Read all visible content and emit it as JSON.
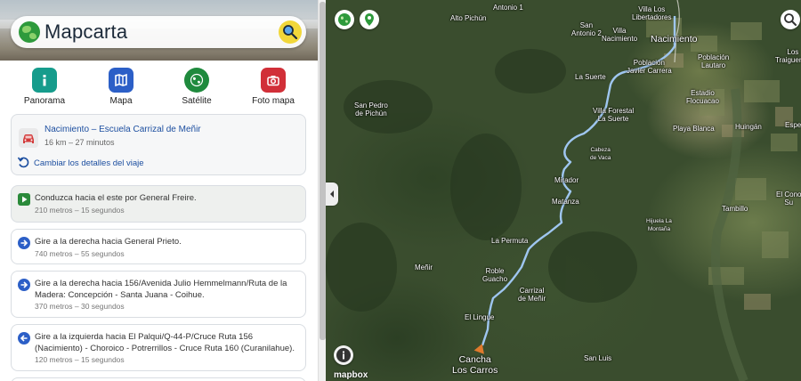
{
  "app": {
    "brand": "Mapcarta"
  },
  "modes": [
    {
      "label": "Panorama",
      "icon": "info-icon"
    },
    {
      "label": "Mapa",
      "icon": "map-icon"
    },
    {
      "label": "Satélite",
      "icon": "globe-icon"
    },
    {
      "label": "Foto mapa",
      "icon": "camera-icon"
    }
  ],
  "trip": {
    "title": "Nacimiento – Escuela Carrizal de Meñir",
    "meta": "16 km – 27 minutos",
    "change_label": "Cambiar los detalles del viaje"
  },
  "steps": [
    {
      "text": "Conduzca hacia el este por General Freire.",
      "meta": "210 metros – 15 segundos",
      "icon": "play-icon"
    },
    {
      "text": "Gire a la derecha hacia General Prieto.",
      "meta": "740 metros – 55 segundos",
      "icon": "arrow-right-icon"
    },
    {
      "text": "Gire a la derecha hacia 156/Avenida Julio Hemmelmann/Ruta de la Madera: Concepción - Santa Juana - Coihue.",
      "meta": "370 metros – 30 segundos",
      "icon": "arrow-right-icon"
    },
    {
      "text": "Gire a la izquierda hacia El Palqui/Q-44-P/Cruce Ruta 156 (Nacimiento) - Choroico - Potrerrillos - Cruce Ruta 160 (Curanilahue).",
      "meta": "120 metros – 15 segundos",
      "icon": "arrow-left-icon"
    }
  ],
  "map": {
    "places": {
      "antonio1": "Antonio 1",
      "alto_pichun": "Alto Pichún",
      "villa_libertadores": "Villa Los\nLibertadores",
      "san_antonio2": "San\nAntonio 2",
      "villa_nacimiento": "Villa\nNacimiento",
      "nacimiento": "Nacimiento",
      "poblacion_jc": "Población\nJavier Carrera",
      "poblacion_lautaro": "Población\nLautaro",
      "los_traiguenes": "Los\nTraiguenes",
      "la_suerte": "La Suerte",
      "estadio": "Estadio\nFlocuacao",
      "san_pedro": "San Pedro\nde Pichún",
      "villa_forestal": "Villa Forestal\nLa Suerte",
      "playa_blanca": "Playa Blanca",
      "huingan": "Huingán",
      "espe": "Espe",
      "cabeza_vaca": "Cabeza\nde Vaca",
      "mirador": "Mirador",
      "matanza": "Matanza",
      "tambillo": "Tambillo",
      "el_cono": "El Cono\nSu",
      "hijuela": "Hijuela La\nMontaña",
      "la_permuta": "La Permuta",
      "menir": "Meñir",
      "roble_guacho": "Roble\nGuacho",
      "carrizal": "Carrizal\nde Meñir",
      "el_lingue": "El Lingue",
      "cancha": "Cancha\nLos Carros",
      "san_luis": "San Luis"
    },
    "attribution": "mapbox"
  }
}
